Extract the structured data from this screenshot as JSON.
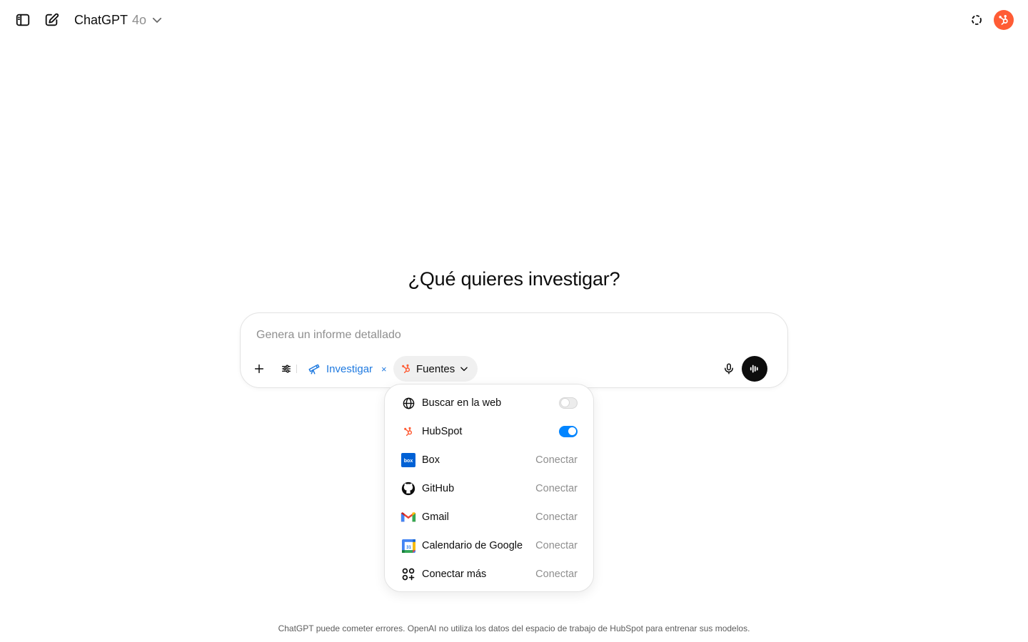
{
  "header": {
    "model_name": "ChatGPT",
    "model_version": "4o",
    "icons": {
      "sidebar": "sidebar-toggle-icon",
      "new_chat": "new-chat-icon",
      "model_dropdown": "chevron-down-icon",
      "temporary_chat": "dashed-circle-icon",
      "avatar": "hubspot-logo-icon"
    }
  },
  "main": {
    "headline": "¿Qué quieres investigar?"
  },
  "composer": {
    "placeholder": "Genera un informe detallado",
    "investigar_label": "Investigar",
    "investigar_remove": "×",
    "fuentes_label": "Fuentes"
  },
  "sources_menu": {
    "items": [
      {
        "label": "Buscar en la web",
        "icon": "globe-icon",
        "state": "off"
      },
      {
        "label": "HubSpot",
        "icon": "hubspot-icon",
        "state": "on"
      },
      {
        "label": "Box",
        "icon": "box-icon",
        "action": "Conectar"
      },
      {
        "label": "GitHub",
        "icon": "github-icon",
        "action": "Conectar"
      },
      {
        "label": "Gmail",
        "icon": "gmail-icon",
        "action": "Conectar"
      },
      {
        "label": "Calendario de Google",
        "icon": "google-calendar-icon",
        "action": "Conectar"
      },
      {
        "label": "Conectar más",
        "icon": "apps-plus-icon",
        "action": "Conectar"
      }
    ]
  },
  "footer": {
    "disclaimer": "ChatGPT puede cometer errores. OpenAI no utiliza los datos del espacio de trabajo de HubSpot para entrenar sus modelos."
  },
  "colors": {
    "accent_blue": "#0285ff",
    "investigar_blue": "#1f7ae0",
    "hubspot_orange": "#ff5c35",
    "muted_text": "#8f8f8f"
  }
}
